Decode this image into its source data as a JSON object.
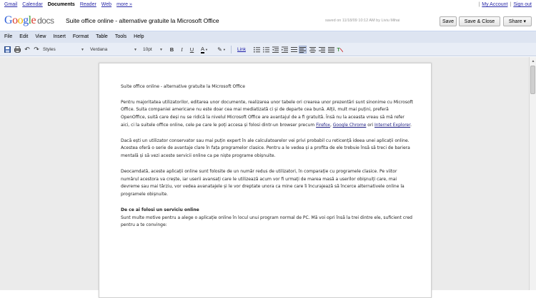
{
  "gbar": {
    "links": [
      "Gmail",
      "Calendar",
      "Documents",
      "Reader",
      "Web",
      "more »"
    ],
    "active": "Documents",
    "account": "My Account",
    "divider": "|",
    "signout": "Sign out"
  },
  "header": {
    "logo_letters": [
      "G",
      "o",
      "o",
      "g",
      "l",
      "e"
    ],
    "logo_product": "docs",
    "doc_title": "Suite office online - alternative gratuite la Microsoft Office",
    "saved_text": "saved on 11/18/09 10:12 AM by Liviu Mihai",
    "save_label": "Save",
    "save_close_label": "Save & Close",
    "share_label": "Share ▾"
  },
  "menu": [
    "File",
    "Edit",
    "View",
    "Insert",
    "Format",
    "Table",
    "Tools",
    "Help"
  ],
  "toolbar": {
    "styles": "Styles",
    "font": "Verdana",
    "size": "10pt",
    "bold": "B",
    "italic": "I",
    "underline": "U",
    "link": "Link"
  },
  "document": {
    "title_line": "Suite office online - alternative gratuite la Microsoft Office",
    "p1_a": "Pentru majoritatea utilizatorilor, editarea unor documente, realizarea unor tabele ori crearea unor prezentări sunt sinonime cu Microsoft Office. Suita companiei americane nu este doar cea mai mediatizată ci și de departe cea bună. Alții, mult mai puțini, preferă OpenOffice, suită care deși nu se ridică la nivelul Microsoft Office are avantajul de a fi gratuită. Însă nu la aceasta vreau să mă refer aici, ci la suitele office online, cele pe care le poți accesa și folosi dintr-un browser precum ",
    "link_firefox": "Firefox",
    "sep1": ", ",
    "link_chrome": "Google Chrome",
    "sep2": " ori ",
    "link_ie": "Internet Explorer",
    "p1_end": ".",
    "p2": "Dacă ești un utilizator conservator sau mai puțin expert în ale calculatoarelor vei privi probabil cu reticență ideea unei aplicații online. Acestea oferă o serie de avantaje clare în fața programelor clasice. Pentru a le vedea și a profita de ele trebuie însă să treci de bariera mentală și să vezi aceste servicii online ca pe niște programe obișnuite.",
    "p3": "Deocamdată, aceste aplicații online sunt folosite de un număr redus de utilizatori, în comparație cu programele clasice. Pe viitor numărul acestora va crește, iar userii avansați care le utilizează acum vor fi urmați de marea masă a userilor obișnuiți care, mai devreme sau mai târziu, vor vedea avanatajele și le vor dreptate unora ca mine care îi încurajează să încerce alternativele online la programele obișnuite.",
    "heading": "De ce ai folosi un serviciu online",
    "p4": "Sunt multe motive pentru a alege o aplicație online în locul unui program normal de PC. Mă voi opri însă la trei dintre ele, suficient cred pentru a te convinge:"
  }
}
